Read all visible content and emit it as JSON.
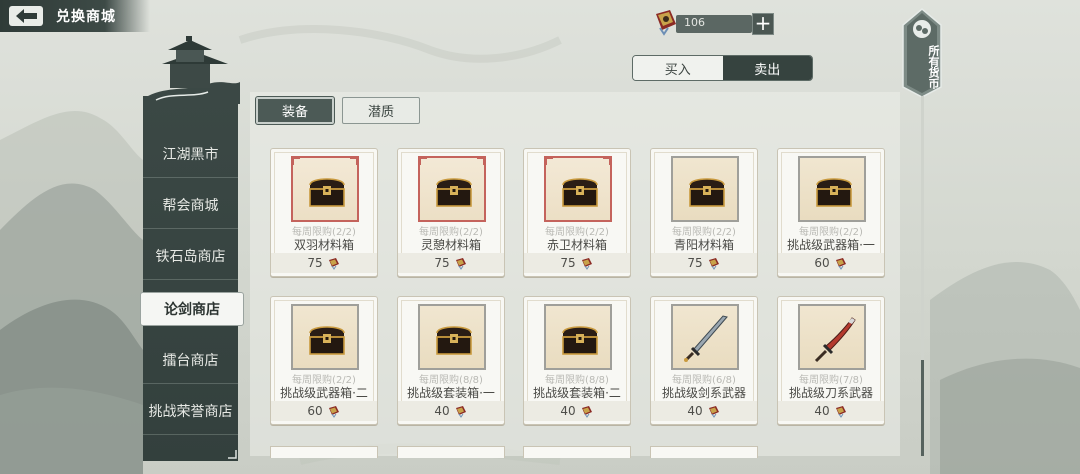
{
  "header": {
    "title": "兑换商城",
    "currency_value": "106",
    "currency_icon": "token-bag-icon",
    "plus_label": "+"
  },
  "mode_toggle": {
    "buy_label": "买入",
    "sell_label": "卖出",
    "active": "sell"
  },
  "all_currency": {
    "label": "所有货币"
  },
  "sidebar": {
    "items": [
      {
        "label": "江湖黑市",
        "active": false
      },
      {
        "label": "帮会商城",
        "active": false
      },
      {
        "label": "铁石岛商店",
        "active": false
      },
      {
        "label": "论剑商店",
        "active": true
      },
      {
        "label": "擂台商店",
        "active": false
      },
      {
        "label": "挑战荣誉商店",
        "active": false
      }
    ]
  },
  "tabs": [
    {
      "label": "装备",
      "active": true
    },
    {
      "label": "潜质",
      "active": false
    }
  ],
  "items": [
    {
      "name": "双羽材料箱",
      "limit": "每周限购(2/2)",
      "price": "75",
      "icon": "chest-icon",
      "frame": "red"
    },
    {
      "name": "灵憩材料箱",
      "limit": "每周限购(2/2)",
      "price": "75",
      "icon": "chest-icon",
      "frame": "red"
    },
    {
      "name": "赤卫材料箱",
      "limit": "每周限购(2/2)",
      "price": "75",
      "icon": "chest-icon",
      "frame": "red"
    },
    {
      "name": "青阳材料箱",
      "limit": "每周限购(2/2)",
      "price": "75",
      "icon": "chest-icon",
      "frame": "grey"
    },
    {
      "name": "挑战级武器箱·一",
      "limit": "每周限购(2/2)",
      "price": "60",
      "icon": "chest-icon",
      "frame": "grey"
    },
    {
      "name": "挑战级武器箱·二",
      "limit": "每周限购(2/2)",
      "price": "60",
      "icon": "chest-icon",
      "frame": "grey"
    },
    {
      "name": "挑战级套装箱·一",
      "limit": "每周限购(8/8)",
      "price": "40",
      "icon": "chest-icon",
      "frame": "grey"
    },
    {
      "name": "挑战级套装箱·二",
      "limit": "每周限购(8/8)",
      "price": "40",
      "icon": "chest-icon",
      "frame": "grey"
    },
    {
      "name": "挑战级剑系武器",
      "limit": "每周限购(6/8)",
      "price": "40",
      "icon": "sword-icon",
      "frame": "grey"
    },
    {
      "name": "挑战级刀系武器",
      "limit": "每周限购(7/8)",
      "price": "40",
      "icon": "saber-icon",
      "frame": "grey"
    }
  ],
  "colors": {
    "dark_panel": "#36433f",
    "accent_red": "#c4635c",
    "card_bg": "#f8f8f4"
  }
}
